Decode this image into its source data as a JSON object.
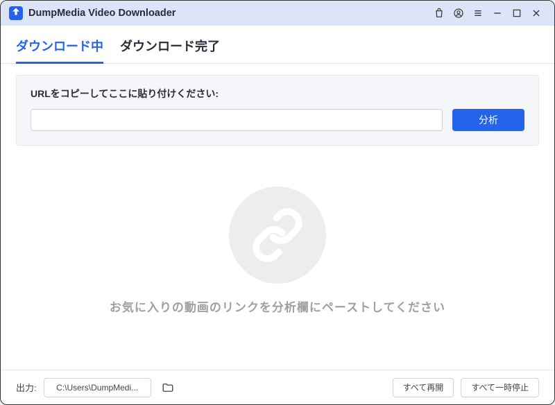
{
  "app": {
    "title": "DumpMedia Video Downloader"
  },
  "tabs": {
    "downloading": "ダウンロード中",
    "completed": "ダウンロード完了"
  },
  "url_panel": {
    "label": "URLをコピーしてここに貼り付けください:",
    "input_value": "",
    "analyze_label": "分析"
  },
  "empty": {
    "hint": "お気に入りの動画のリンクを分析欄にペーストしてください"
  },
  "footer": {
    "output_label": "出力:",
    "output_path": "C:\\Users\\DumpMedi...",
    "resume_all": "すべて再開",
    "pause_all": "すべて一時停止"
  }
}
